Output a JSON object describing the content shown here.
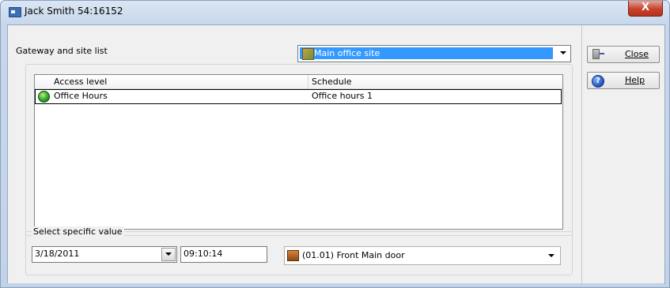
{
  "window": {
    "title": "Jack Smith  54:16152",
    "close_glyph": "X"
  },
  "gateway": {
    "label": "Gateway and site list",
    "selected_site": "Main office site",
    "site_icon": "site-icon"
  },
  "access_list": {
    "columns": [
      "Access level",
      "Schedule"
    ],
    "rows": [
      {
        "access_level": "Office Hours",
        "schedule": "Office hours 1",
        "icon": "green-access-icon"
      }
    ]
  },
  "specific_value": {
    "legend": "Select specific value",
    "date": "3/18/2011",
    "time": "09:10:14",
    "door": "(01.01) Front Main door",
    "door_icon": "door-icon"
  },
  "buttons": {
    "close": "Close",
    "help": "Help"
  },
  "colors": {
    "selection": "#3399ff",
    "title_bar": "#c7d7eb",
    "close_button": "#c7422b"
  }
}
